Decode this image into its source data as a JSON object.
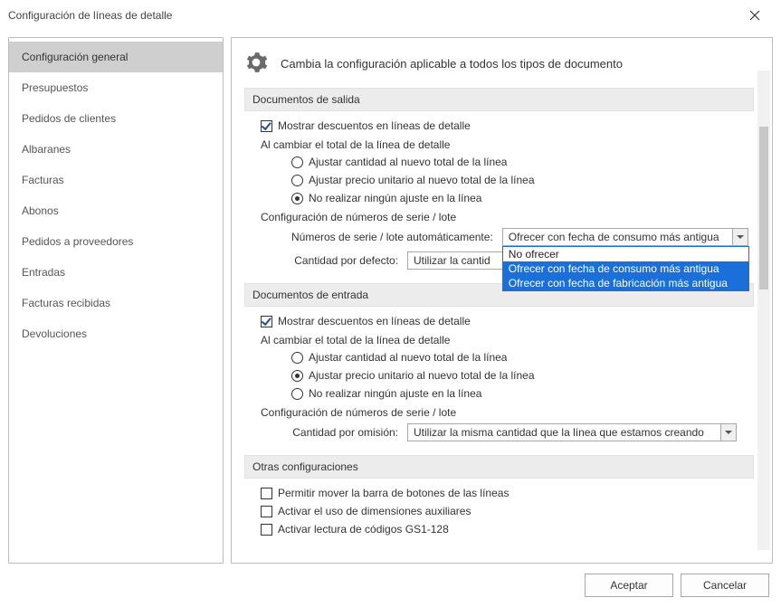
{
  "window": {
    "title": "Configuración de líneas de detalle"
  },
  "sidebar": {
    "items": [
      {
        "label": "Configuración general",
        "selected": true
      },
      {
        "label": "Presupuestos"
      },
      {
        "label": "Pedidos de clientes"
      },
      {
        "label": "Albaranes"
      },
      {
        "label": "Facturas"
      },
      {
        "label": "Abonos"
      },
      {
        "label": "Pedidos a proveedores"
      },
      {
        "label": "Entradas"
      },
      {
        "label": "Facturas recibidas"
      },
      {
        "label": "Devoluciones"
      }
    ]
  },
  "header": {
    "text": "Cambia la configuración aplicable a todos los tipos de documento"
  },
  "sections": {
    "salida": {
      "title": "Documentos de salida",
      "show_discounts": {
        "label": "Mostrar descuentos en líneas de detalle",
        "checked": true
      },
      "on_total_change": {
        "label": "Al cambiar el total de la línea de detalle",
        "options": [
          {
            "label": "Ajustar cantidad al nuevo total de la línea",
            "checked": false
          },
          {
            "label": "Ajustar precio unitario al nuevo total de la línea",
            "checked": false
          },
          {
            "label": "No realizar ningún ajuste en la línea",
            "checked": true
          }
        ]
      },
      "serial_config": {
        "label": "Configuración de números de serie / lote",
        "auto_label": "Números de serie / lote automáticamente:",
        "auto_value": "Ofrecer con fecha de consumo más antigua",
        "auto_options": [
          "No ofrecer",
          "Ofrecer con fecha de consumo más antigua",
          "Ofrecer con fecha de fabricación más antigua"
        ],
        "auto_selected_index": 1,
        "qty_label": "Cantidad por defecto:",
        "qty_value": "Utilizar la cantid"
      }
    },
    "entrada": {
      "title": "Documentos de entrada",
      "show_discounts": {
        "label": "Mostrar descuentos en líneas de detalle",
        "checked": true
      },
      "on_total_change": {
        "label": "Al cambiar el total de la línea de detalle",
        "options": [
          {
            "label": "Ajustar cantidad al nuevo total de la línea",
            "checked": false
          },
          {
            "label": "Ajustar precio unitario al nuevo total de la línea",
            "checked": true
          },
          {
            "label": "No realizar ningún ajuste en la línea",
            "checked": false
          }
        ]
      },
      "serial_config": {
        "label": "Configuración de números de serie / lote",
        "qty_label": "Cantidad por omisión:",
        "qty_value": "Utilizar la misma cantidad que la línea que estamos creando"
      }
    },
    "otras": {
      "title": "Otras configuraciones",
      "items": [
        {
          "label": "Permitir mover la barra de botones de las líneas",
          "checked": false
        },
        {
          "label": "Activar el uso de dimensiones auxiliares",
          "checked": false
        },
        {
          "label": "Activar lectura de códigos GS1-128",
          "checked": false
        }
      ]
    }
  },
  "footer": {
    "ok": "Aceptar",
    "cancel": "Cancelar"
  }
}
